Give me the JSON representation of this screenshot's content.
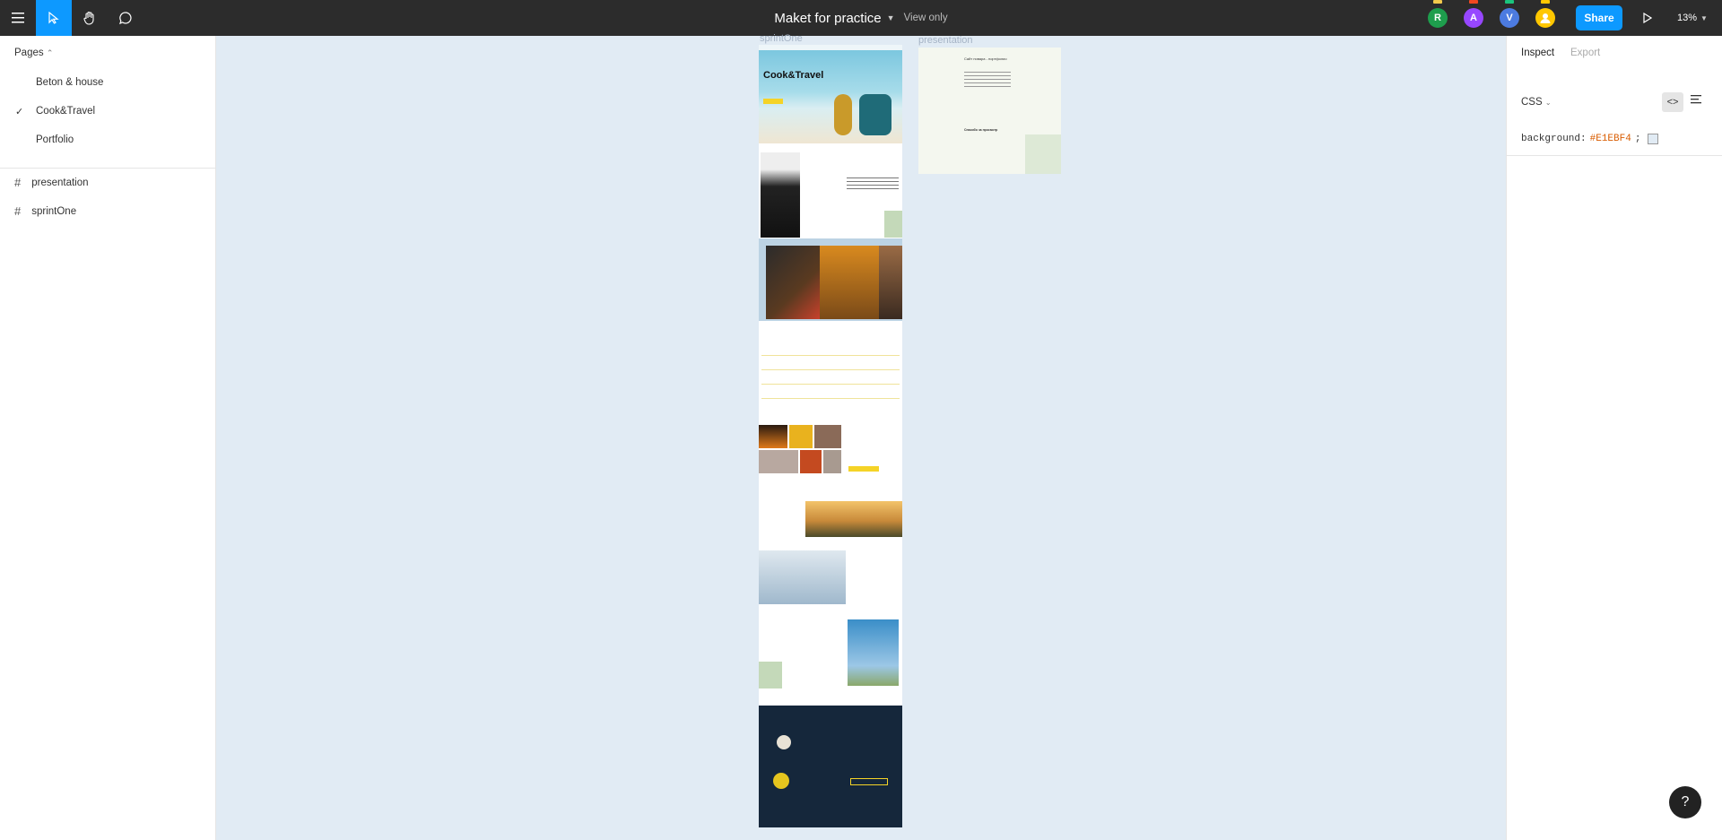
{
  "app": {
    "file_name": "Maket for practice",
    "mode": "View only",
    "share_label": "Share",
    "zoom": "13%"
  },
  "toolbar": {
    "icons": [
      "menu-icon",
      "move-pointer-icon",
      "hand-icon",
      "comment-icon",
      "play-icon"
    ]
  },
  "collaborators": [
    {
      "initial": "R",
      "color": "#1e9e4d",
      "tick": "#f2c94c"
    },
    {
      "initial": "A",
      "color": "#9747ff",
      "tick": "#f24822"
    },
    {
      "initial": "V",
      "color": "#4c7be0",
      "tick": "#1bc47d"
    },
    {
      "initial": "",
      "color": "#ffc700",
      "tick": "#ffc700"
    }
  ],
  "pages_panel": {
    "header": "Pages",
    "pages": [
      {
        "label": "Beton & house",
        "selected": false
      },
      {
        "label": "Cook&Travel",
        "selected": true
      },
      {
        "label": "Portfolio",
        "selected": false
      }
    ],
    "layers": [
      {
        "label": "presentation"
      },
      {
        "label": "sprintOne"
      }
    ]
  },
  "inspect_panel": {
    "tab_inspect": "Inspect",
    "tab_export": "Export",
    "language": "CSS",
    "css_property": "background:",
    "css_value": "#E1EBF4",
    "css_semicolon": ";"
  },
  "canvas": {
    "background": "#E1EBF4",
    "frames": [
      {
        "label": "sprintOne"
      },
      {
        "label": "presentation"
      }
    ],
    "sprintone": {
      "hero_title": "Cook&Travel",
      "hero_button_color": "#f5d327"
    },
    "presentation": {
      "heading": "Сайт повара - портфолио",
      "section": "Спасибо за просмотр"
    },
    "help_label": "?"
  }
}
